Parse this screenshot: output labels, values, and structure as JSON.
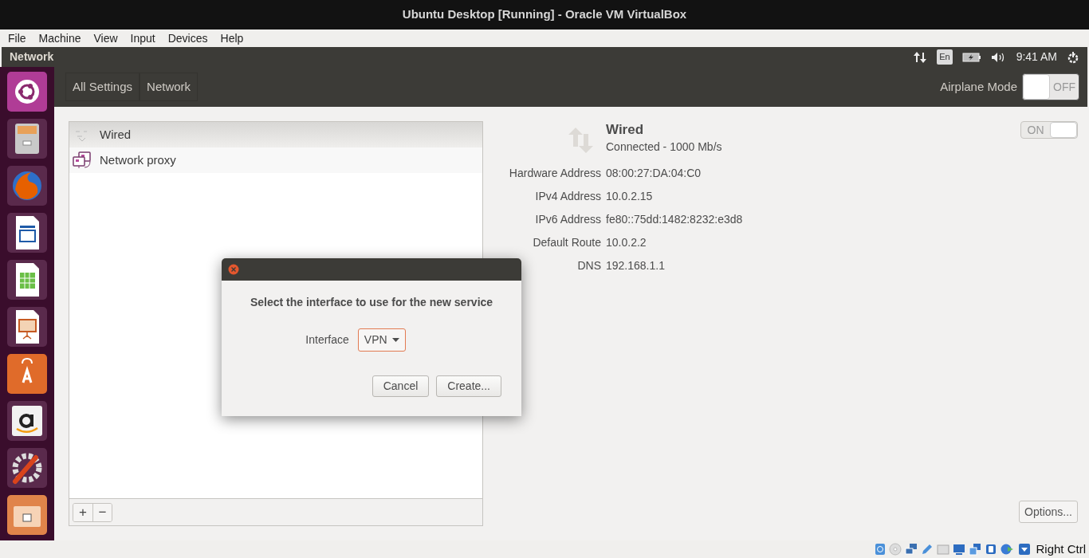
{
  "window": {
    "title": "Ubuntu Desktop [Running] - Oracle VM VirtualBox"
  },
  "menu_bar": [
    "File",
    "Machine",
    "View",
    "Input",
    "Devices",
    "Help"
  ],
  "top_panel": {
    "app_title": "Network",
    "keyboard": "En",
    "clock": "9:41 AM"
  },
  "launcher": [
    {
      "kind": "ubuntu"
    },
    {
      "kind": "files"
    },
    {
      "kind": "browser"
    },
    {
      "kind": "writer"
    },
    {
      "kind": "calc"
    },
    {
      "kind": "impress"
    },
    {
      "kind": "software"
    },
    {
      "kind": "amazon"
    },
    {
      "kind": "settings"
    },
    {
      "kind": "folder"
    }
  ],
  "toolbar": {
    "breadcrumbs": [
      "All Settings",
      "Network"
    ],
    "airplane_mode": {
      "label": "Airplane Mode",
      "on": false,
      "state_text": "OFF"
    }
  },
  "connections": [
    {
      "label": "Wired",
      "kind": "wired",
      "selected": true
    },
    {
      "label": "Network proxy",
      "kind": "proxy",
      "selected": false
    }
  ],
  "list_buttons": [
    "+",
    "−"
  ],
  "details": {
    "title": "Wired",
    "status": "Connected - 1000 Mb/s",
    "switch": {
      "on": true,
      "state_text": "ON"
    },
    "rows": [
      {
        "label": "Hardware Address",
        "value": "08:00:27:DA:04:C0"
      },
      {
        "label": "IPv4 Address",
        "value": "10.0.2.15"
      },
      {
        "label": "IPv6 Address",
        "value": "fe80::75dd:1482:8232:e3d8"
      },
      {
        "label": "Default Route",
        "value": "10.0.2.2"
      },
      {
        "label": "DNS",
        "value": "192.168.1.1"
      }
    ]
  },
  "options_button": "Options...",
  "dialog": {
    "prompt": "Select the interface to use for the new service",
    "interface_label": "Interface",
    "interface_value": "VPN",
    "buttons": [
      "Cancel",
      "Create..."
    ]
  },
  "status_bar": {
    "host_key": "Right Ctrl"
  }
}
